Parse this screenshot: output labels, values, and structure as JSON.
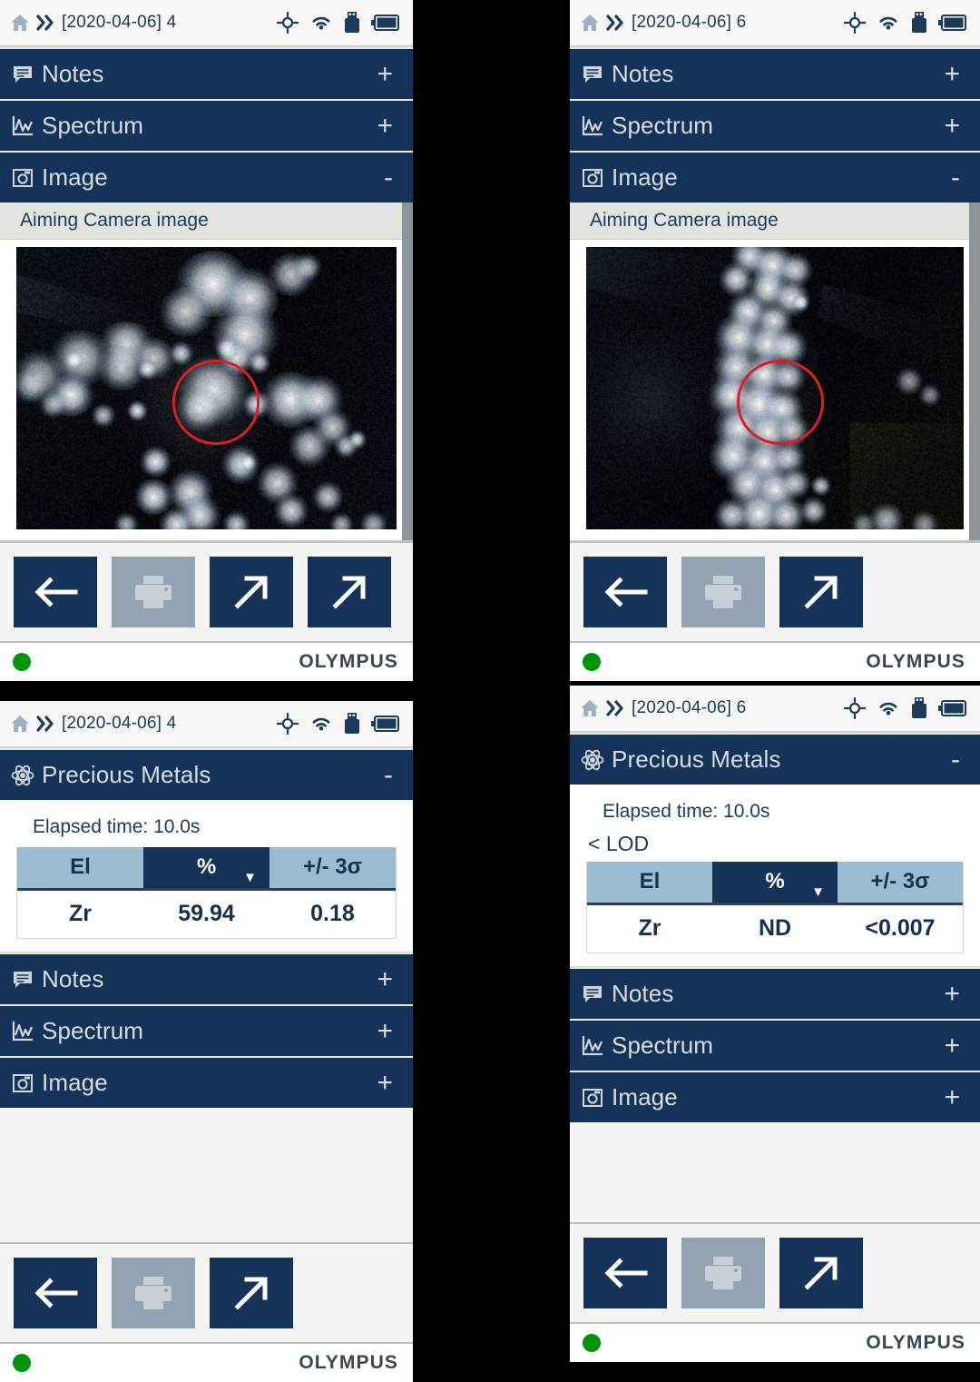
{
  "theme": {
    "header_blue": "#153358",
    "header_text": "#d7dde5",
    "status_bg": "#f7f7f5",
    "status_text": "#1b3a5c",
    "table_header_light": "#9bbdd1",
    "table_header_selected": "#153358",
    "reticle_red": "#d81f26",
    "status_dot_green": "#009409",
    "brand_gray": "#3b4650",
    "button_blue": "#153358",
    "button_disabled_gray": "#94a3b3"
  },
  "icons": {
    "home": "home-icon",
    "breadcrumb": "double-chevron-right-icon",
    "gps": "gps-target-icon",
    "wifi": "wifi-icon",
    "usb": "usb-drive-icon",
    "battery": "battery-icon",
    "notes": "notes-icon",
    "spectrum": "spectrum-chart-icon",
    "image": "camera-image-icon",
    "atom": "atom-icon",
    "back": "back-arrow-icon",
    "print": "printer-icon",
    "export": "diagonal-arrow-up-right-icon",
    "chevron_down": "chevron-down-icon"
  },
  "panels": [
    {
      "id": "panel-top-left",
      "statusbar": {
        "title": "[2020-04-06] 4"
      },
      "sections": [
        {
          "name": "notes",
          "label": "Notes",
          "toggle": "+",
          "icon": "notes-icon"
        },
        {
          "name": "spectrum",
          "label": "Spectrum",
          "toggle": "+",
          "icon": "spectrum-chart-icon"
        },
        {
          "name": "image",
          "label": "Image",
          "toggle": "-",
          "icon": "camera-image-icon"
        }
      ],
      "image_panel": {
        "caption": "Aiming Camera image",
        "variant": "cluster"
      },
      "buttons": [
        {
          "name": "back-button",
          "icon": "back-arrow-icon",
          "disabled": false
        },
        {
          "name": "print-button",
          "icon": "printer-icon",
          "disabled": true
        },
        {
          "name": "export-button-1",
          "icon": "diagonal-arrow-up-right-icon",
          "disabled": false
        },
        {
          "name": "export-button-2",
          "icon": "diagonal-arrow-up-right-icon",
          "disabled": false
        }
      ],
      "footer": {
        "status": "ready",
        "brand": "OLYMPUS"
      }
    },
    {
      "id": "panel-top-right",
      "statusbar": {
        "title": "[2020-04-06] 6"
      },
      "sections": [
        {
          "name": "notes",
          "label": "Notes",
          "toggle": "+",
          "icon": "notes-icon"
        },
        {
          "name": "spectrum",
          "label": "Spectrum",
          "toggle": "+",
          "icon": "spectrum-chart-icon"
        },
        {
          "name": "image",
          "label": "Image",
          "toggle": "-",
          "icon": "camera-image-icon"
        }
      ],
      "image_panel": {
        "caption": "Aiming Camera image",
        "variant": "vein"
      },
      "buttons": [
        {
          "name": "back-button",
          "icon": "back-arrow-icon",
          "disabled": false
        },
        {
          "name": "print-button",
          "icon": "printer-icon",
          "disabled": true
        },
        {
          "name": "export-button",
          "icon": "diagonal-arrow-up-right-icon",
          "disabled": false
        }
      ],
      "footer": {
        "status": "ready",
        "brand": "OLYMPUS"
      }
    },
    {
      "id": "panel-bottom-left",
      "statusbar": {
        "title": "[2020-04-06] 4"
      },
      "results": {
        "title": "Precious Metals",
        "toggle": "-",
        "elapsed": "Elapsed time: 10.0s",
        "lod_note": "",
        "columns": [
          "El",
          "%",
          "+/- 3σ"
        ],
        "selected_column": "%",
        "rows": [
          {
            "el": "Zr",
            "pct": "59.94",
            "err": "0.18"
          }
        ]
      },
      "sections": [
        {
          "name": "notes",
          "label": "Notes",
          "toggle": "+",
          "icon": "notes-icon"
        },
        {
          "name": "spectrum",
          "label": "Spectrum",
          "toggle": "+",
          "icon": "spectrum-chart-icon"
        },
        {
          "name": "image",
          "label": "Image",
          "toggle": "+",
          "icon": "camera-image-icon"
        }
      ],
      "buttons": [
        {
          "name": "back-button",
          "icon": "back-arrow-icon",
          "disabled": false
        },
        {
          "name": "print-button",
          "icon": "printer-icon",
          "disabled": true
        },
        {
          "name": "export-button",
          "icon": "diagonal-arrow-up-right-icon",
          "disabled": false
        }
      ],
      "footer": {
        "status": "ready",
        "brand": "OLYMPUS"
      }
    },
    {
      "id": "panel-bottom-right",
      "statusbar": {
        "title": "[2020-04-06] 6"
      },
      "results": {
        "title": "Precious Metals",
        "toggle": "-",
        "elapsed": "Elapsed time: 10.0s",
        "lod_note": "< LOD",
        "columns": [
          "El",
          "%",
          "+/- 3σ"
        ],
        "selected_column": "%",
        "rows": [
          {
            "el": "Zr",
            "pct": "ND",
            "err": "<0.007"
          }
        ]
      },
      "sections": [
        {
          "name": "notes",
          "label": "Notes",
          "toggle": "+",
          "icon": "notes-icon"
        },
        {
          "name": "spectrum",
          "label": "Spectrum",
          "toggle": "+",
          "icon": "spectrum-chart-icon"
        },
        {
          "name": "image",
          "label": "Image",
          "toggle": "+",
          "icon": "camera-image-icon"
        }
      ],
      "buttons": [
        {
          "name": "back-button",
          "icon": "back-arrow-icon",
          "disabled": false
        },
        {
          "name": "print-button",
          "icon": "printer-icon",
          "disabled": true
        },
        {
          "name": "export-button",
          "icon": "diagonal-arrow-up-right-icon",
          "disabled": false
        }
      ],
      "footer": {
        "status": "ready",
        "brand": "OLYMPUS"
      }
    }
  ]
}
